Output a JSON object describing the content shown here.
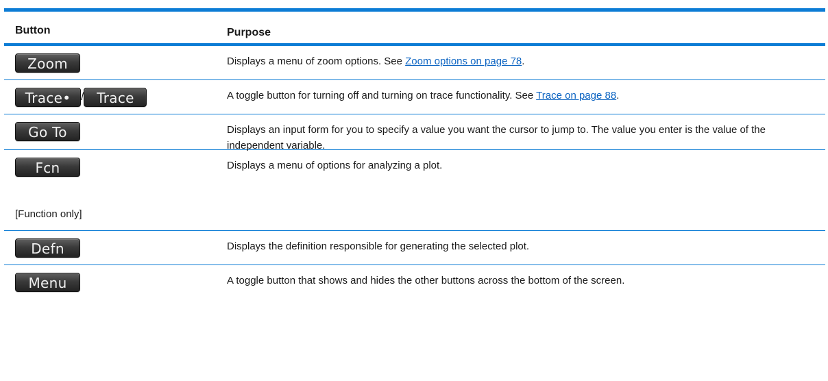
{
  "header": {
    "col1": "Button",
    "col2": "Purpose"
  },
  "rows": {
    "zoom": {
      "buttons": [
        "Zoom"
      ],
      "text": "Displays a menu of zoom options. See ",
      "link": "Zoom options on page 78",
      "after": "."
    },
    "trace": {
      "buttons": [
        "Trace•",
        "Trace"
      ],
      "separator": "/",
      "text": "A toggle button for turning off and turning on trace functionality. See ",
      "link": "Trace on page 88",
      "after": "."
    },
    "goto": {
      "buttons": [
        "Go To"
      ],
      "text": "Displays an input form for you to specify a value you want the cursor to jump to. The value you enter is the value of the independent variable."
    },
    "fcn": {
      "buttons": [
        "Fcn"
      ],
      "text": "Displays a menu of options for analyzing a plot.",
      "note": "[Function only]"
    },
    "defn": {
      "buttons": [
        "Defn"
      ],
      "text": "Displays the definition responsible for generating the selected plot."
    },
    "menu": {
      "buttons": [
        "Menu"
      ],
      "text": "A toggle button that shows and hides the other buttons across the bottom of the screen."
    }
  },
  "colors": {
    "accent": "#0c7cd5",
    "link": "#0c64c2",
    "button_bg": "#3a3a3a"
  }
}
